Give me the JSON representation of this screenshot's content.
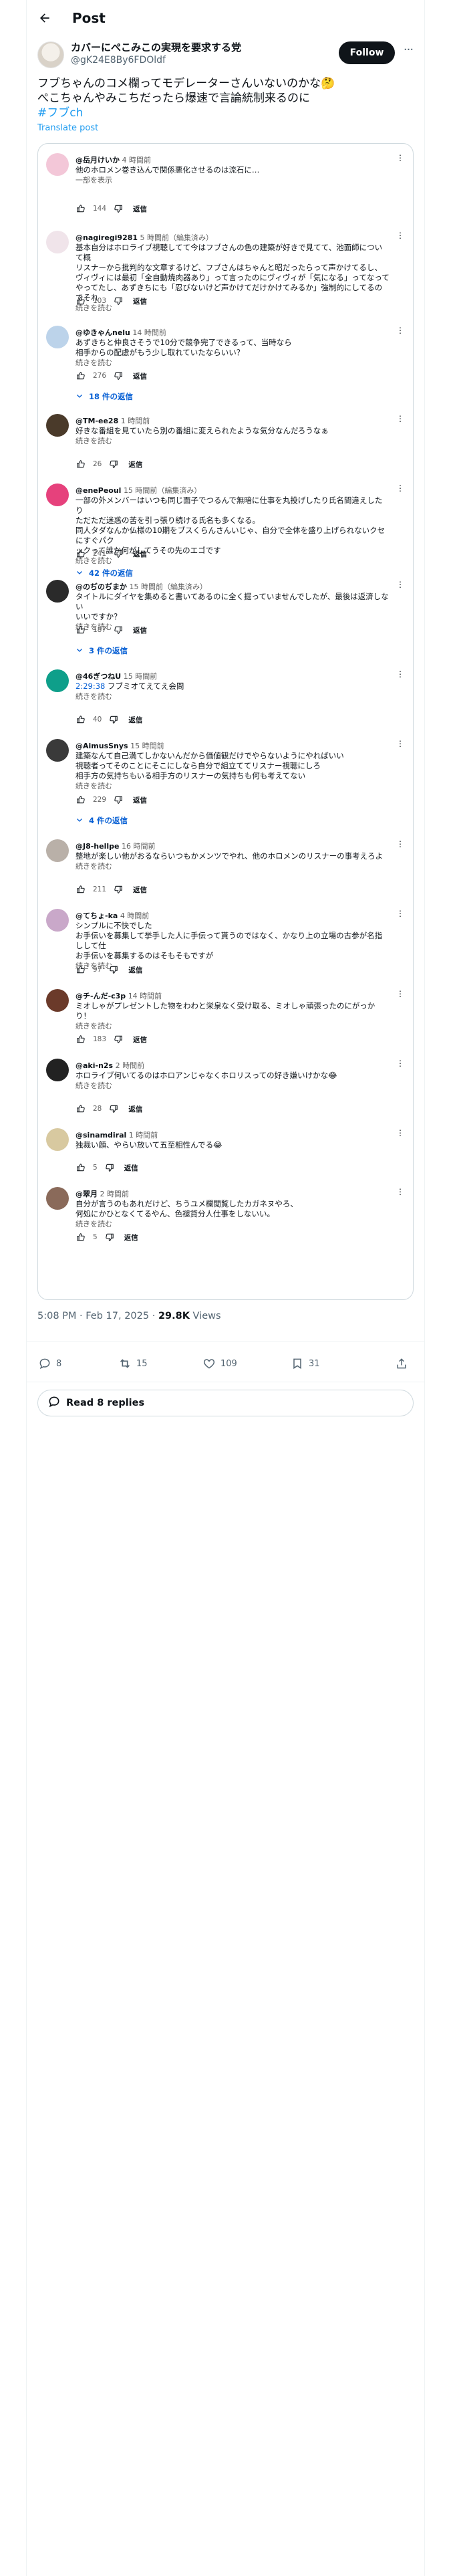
{
  "header": {
    "title": "Post"
  },
  "author": {
    "display_name": "カバーにぺこみこの実現を要求する党",
    "handle": "@gK24E8By6FDOldf",
    "follow_label": "Follow"
  },
  "tweet": {
    "line1": "フブちゃんのコメ欄ってモデレーターさんいないのかな🤔",
    "line2": "ぺこちゃんやみこちだったら爆速で言論統制来るのに",
    "hashtag": "#フブch",
    "translate_label": "Translate post"
  },
  "comments": [
    {
      "handle": "@岳月けいか",
      "time": "4 時間前",
      "lines": [
        "他のホロメン巻き込んで関係悪化させるのは流石に…"
      ],
      "more": "一部を表示",
      "likes": "144",
      "reply": "返信"
    },
    {
      "handle": "@nagiregi9281",
      "time": "5 時間前（編集済み）",
      "lines": [
        "基本自分はホロライブ視聴してて今はフブさんの色の建築が好きで見てて、池面師について概",
        "リスナーから批判的な文章するけど、フブさんはちゃんと昭だったらって声かけてるし、",
        "ヴィヴィには最初「全自動焼肉器あり」って言ったのにヴィヴィが「気になる」ってなって",
        "やってたし、あずきちにも「忍びないけど声かけてだけかけてみるか」強制的にしてるのでそれ"
      ],
      "more": "続きを読む",
      "likes": "103",
      "reply": "返信"
    },
    {
      "handle": "@ゆきゃんnelu",
      "time": "14 時間前",
      "lines": [
        "あずきちと仲良さそうで10分で競争完了できるって、当時なら",
        "相手からの配慮がもう少し取れていたならいい？"
      ],
      "more": "続きを読む",
      "likes": "276",
      "reply": "返信",
      "replies": "18 件の返信"
    },
    {
      "handle": "@TM-ee28",
      "time": "1 時間前",
      "lines": [
        "好きな番組を見ていたら別の番組に変えられたような気分なんだろうなぁ"
      ],
      "more": "続きを読む",
      "likes": "26",
      "reply": "返信"
    },
    {
      "handle": "@enePeoul",
      "time": "15 時間前（編集済み）",
      "lines": [
        "一部の外メンバーはいつも同じ面子でつるんで無暗に仕事を丸投げしたり氏名間違えしたり",
        "ただただ迷惑の苦を引っ張り続ける氏名も多くなる。",
        "同人タダなんか仏様の10期をブスくらんさんいじゃ、自分で全体を盛り上げられないクセにすぐパク",
        "ックって誰か何がしてうその先のエゴです"
      ],
      "more": "続きを読む",
      "likes": "241",
      "reply": "返信",
      "replies": "42 件の返信"
    },
    {
      "handle": "@のぢのぢまか",
      "time": "15 時間前（編集済み）",
      "lines": [
        "タイトルにダイヤを集めると書いてあるのに全く掘っていませんでしたが、最後は返済しない",
        "いいですか？"
      ],
      "more": "続きを読む",
      "likes": "187",
      "reply": "返信",
      "replies": "3 件の返信"
    },
    {
      "handle": "@46ぎつねU",
      "time": "15 時間前",
      "lines": [
        "2:29:38  フブミオてえてえ会問"
      ],
      "link": "2:29:38",
      "more": "続きを読む",
      "likes": "40",
      "reply": "返信"
    },
    {
      "handle": "@AimusSnys",
      "time": "15 時間前",
      "lines": [
        "建築なんて自己満てしかないんだから価値観だけでやらないようにやればいい",
        "視聴者ってそのことにそこにしなら自分で組立ててリスナー視聴にしろ",
        "相手方の気持ちもいる相手方のリスナーの気持ちも何も考えてない"
      ],
      "more": "続きを読む",
      "likes": "229",
      "reply": "返信",
      "replies": "4 件の返信"
    },
    {
      "handle": "@J8-hellpe",
      "time": "16 時間前",
      "lines": [
        "整地が楽しい他がおるならいつもかメンツでやれ、他のホロメンのリスナーの事考えろよ"
      ],
      "more": "続きを読む",
      "likes": "211",
      "reply": "返信"
    },
    {
      "handle": "@てちょ-ka",
      "time": "4 時間前",
      "lines": [
        "シンプルに不快でした",
        "お手伝いを募集して挙手した人に手伝って貰うのではなく、かなり上の立場の古参が名指しして仕",
        "お手伝いを募集するのはそもそもですが"
      ],
      "more": "続きを読む",
      "likes": "97",
      "reply": "返信"
    },
    {
      "handle": "@チ-んだ-c3p",
      "time": "14 時間前",
      "lines": [
        "ミオしゃがプレゼントした物をわわと栄泉なく受け取る、ミオしゃ頑張ったのにがっかり！"
      ],
      "more": "続きを読む",
      "likes": "183",
      "reply": "返信"
    },
    {
      "handle": "@aki-n2s",
      "time": "2 時間前",
      "lines": [
        "ホロライブ何いてるのはホロアンじゃなくホロリスっての好き嫌いけかな😂"
      ],
      "more": "続きを読む",
      "likes": "28",
      "reply": "返信"
    },
    {
      "handle": "@sinamdiral",
      "time": "1 時間前",
      "lines": [
        "独裁い顔、やらい放いて五至相性んでる😂"
      ],
      "more": "",
      "likes": "5",
      "reply": "返信"
    },
    {
      "handle": "@翠月",
      "time": "2 時間前",
      "lines": [
        "自分が言うのもあれだけど、ちうユメ欄閲覧したカガネヌやろ、",
        "何処にかひとなくてるやん、色褪貸分人仕事をしないい。"
      ],
      "more": "続きを読む",
      "likes": "5",
      "reply": "返信"
    }
  ],
  "meta": {
    "time": "5:08 PM · Feb 17, 2025 · ",
    "views_count": "29.8K",
    "views_label": " Views"
  },
  "actions": {
    "replies": "8",
    "reposts": "15",
    "likes": "109",
    "bookmarks": "31"
  },
  "read_replies_label": "Read 8 replies",
  "colors": {
    "accent": "#1d9bf0",
    "link": "#065fd4",
    "text": "#0f1419",
    "muted": "#536471",
    "border": "#cfd9de"
  }
}
